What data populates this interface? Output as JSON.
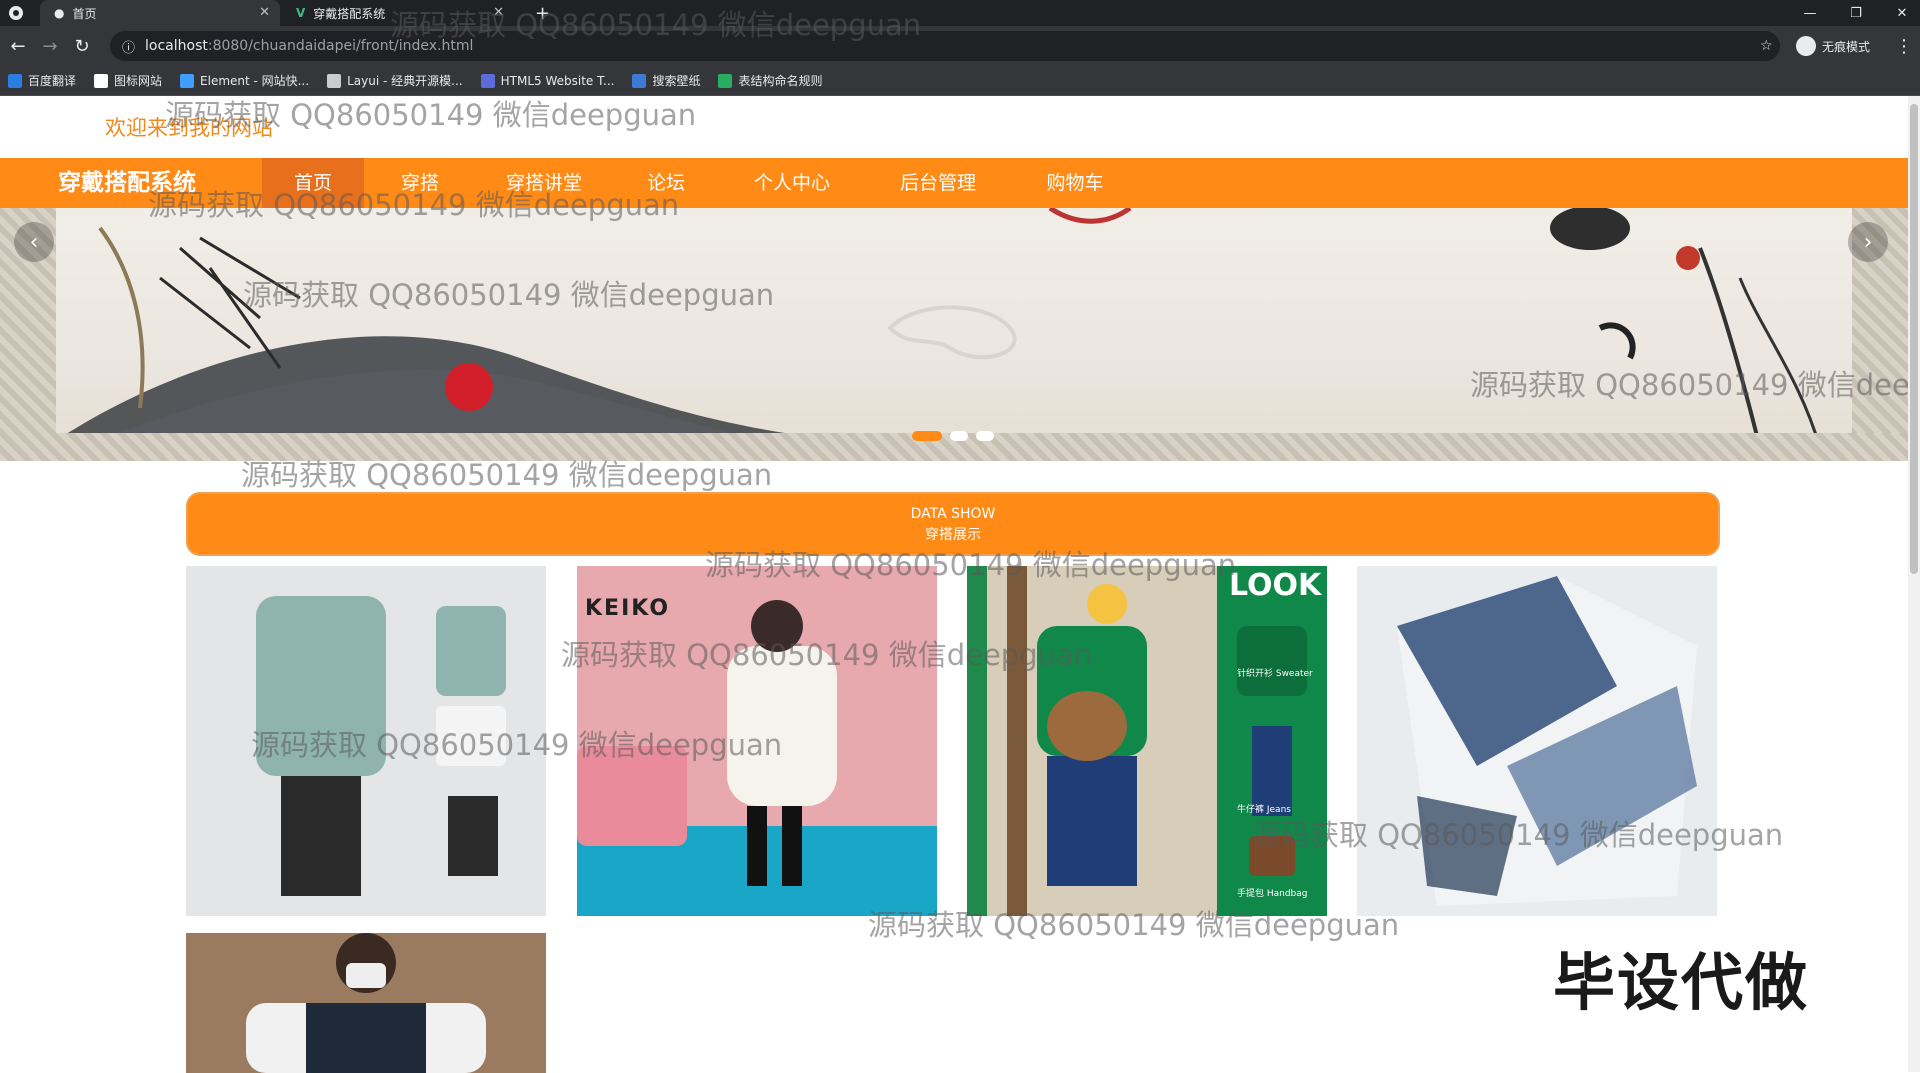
{
  "browser": {
    "tabs": [
      {
        "title": "首页",
        "active": true
      },
      {
        "title": "穿戴搭配系统",
        "active": false
      }
    ],
    "new_tab_glyph": "+",
    "url_host": "localhost",
    "url_path": ":8080/chuandaidapei/front/index.html",
    "incognito_label": "无痕模式",
    "bookmarks": [
      {
        "label": "百度翻译",
        "color": "#2a7de1"
      },
      {
        "label": "图标网站",
        "color": "#ffffff"
      },
      {
        "label": "Element - 网站快...",
        "color": "#409eff"
      },
      {
        "label": "Layui - 经典开源模...",
        "color": "#cccccc"
      },
      {
        "label": "HTML5 Website T...",
        "color": "#5b6cd8"
      },
      {
        "label": "搜索壁纸",
        "color": "#3d7ad6"
      },
      {
        "label": "表结构命名规则",
        "color": "#27ae60"
      }
    ]
  },
  "page": {
    "welcome": "欢迎来到我的网站",
    "brand": "穿戴搭配系统",
    "nav": [
      {
        "label": "首页",
        "active": true
      },
      {
        "label": "穿搭",
        "active": false
      },
      {
        "label": "穿搭讲堂",
        "active": false
      },
      {
        "label": "论坛",
        "active": false
      },
      {
        "label": "个人中心",
        "active": false
      },
      {
        "label": "后台管理",
        "active": false
      },
      {
        "label": "购物车",
        "active": false
      }
    ],
    "banner": {
      "slide_count": 3,
      "active_index": 0
    },
    "section": {
      "title_en": "DATA SHOW",
      "title_cn": "穿搭展示"
    },
    "products": [
      {
        "name": "jacket-set"
      },
      {
        "name": "white-coat"
      },
      {
        "name": "green-sweater-look",
        "print_brand": "LOOK",
        "tags": [
          "针织开衫 Sweater",
          "牛仔裤 Jeans",
          "手提包 Handbag"
        ]
      },
      {
        "name": "printed-shirt"
      },
      {
        "name": "varsity-jacket"
      }
    ],
    "keiko_brand": "KEIKO"
  },
  "overlay": {
    "watermark": "源码获取 QQ86050149 微信deepguan",
    "stamp": "毕设代做"
  },
  "colors": {
    "accent": "#ff8a16",
    "accent_dark": "#e8701c",
    "welcome": "#f08a1c"
  }
}
